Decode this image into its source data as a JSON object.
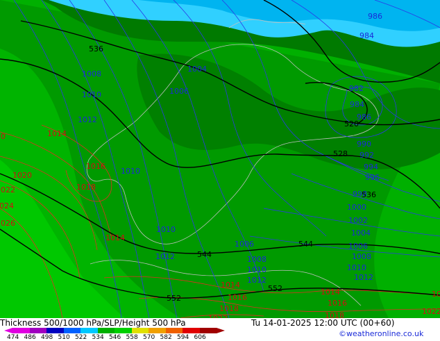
{
  "map": {
    "pressure_labels": [
      "986",
      "984",
      "1008",
      "1004",
      "1010",
      "1006",
      "982",
      "984",
      "986",
      "1012",
      "990",
      "992",
      "994",
      "996",
      "998",
      "1000",
      "1010",
      "1002",
      "1004",
      "1010",
      "1006",
      "1006",
      "1012",
      "1008",
      "1008",
      "1010",
      "1010",
      "1012",
      "1012"
    ],
    "high_pressure_labels": [
      "1014",
      "1016",
      "1018",
      "1020",
      "1022",
      "1024",
      "1026",
      "1014",
      "1014",
      "1016",
      "1016",
      "1014",
      "1018",
      "1016",
      "1022",
      "1022",
      "1018",
      "1020"
    ],
    "thickness_labels": [
      "536",
      "520",
      "528",
      "536",
      "544",
      "544",
      "552",
      "552"
    ],
    "colors": {
      "sea_deep": "#00b4f0",
      "sea_light": "#30d0ff",
      "green_dark": "#007a00",
      "green_mid": "#009200",
      "green_bright": "#00b000",
      "green_light": "#00c800",
      "pressure_contour": "#2a3ae8",
      "high_contour": "#e03020",
      "thickness_contour": "#000000"
    }
  },
  "footer": {
    "title": "Thickness 500/1000 hPa/SLP/Height 500 hPa",
    "valid_time": "Tu 14-01-2025 12:00 UTC (00+60)",
    "credit": "©weatheronline.co.uk",
    "legend": [
      {
        "label": "474",
        "color": "#e000e0"
      },
      {
        "label": "486",
        "color": "#a000c0"
      },
      {
        "label": "498",
        "color": "#0000c0"
      },
      {
        "label": "510",
        "color": "#0060ff"
      },
      {
        "label": "522",
        "color": "#00c8ff"
      },
      {
        "label": "534",
        "color": "#00b000"
      },
      {
        "label": "546",
        "color": "#00d000"
      },
      {
        "label": "558",
        "color": "#e0e000"
      },
      {
        "label": "570",
        "color": "#f0a000"
      },
      {
        "label": "582",
        "color": "#f06000"
      },
      {
        "label": "594",
        "color": "#e00000"
      },
      {
        "label": "606",
        "color": "#a00000"
      }
    ]
  }
}
